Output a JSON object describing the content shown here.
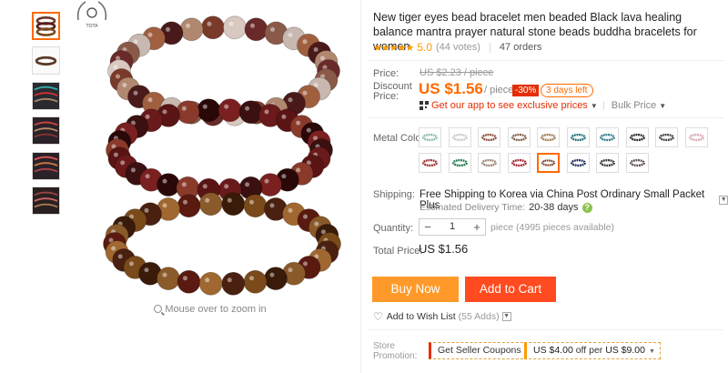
{
  "thumbnails": [
    {
      "name": "thumb-1",
      "selected": true
    },
    {
      "name": "thumb-2",
      "selected": false
    },
    {
      "name": "thumb-3",
      "selected": false
    },
    {
      "name": "thumb-4",
      "selected": false
    },
    {
      "name": "thumb-5",
      "selected": false
    },
    {
      "name": "thumb-6",
      "selected": false
    }
  ],
  "watermark": {
    "text": "TOTA"
  },
  "zoom_hint": "Mouse over to zoom in",
  "product": {
    "title": "New tiger eyes bead bracelet men beaded Black lava healing balance mantra prayer natural stone beads buddha bracelets for women",
    "stars": "★★★★★",
    "rating": "5.0",
    "votes": "(44 votes)",
    "orders": "47 orders"
  },
  "price": {
    "label": "Price:",
    "old_price": "US $2.23 / piece",
    "discount_label_1": "Discount",
    "discount_label_2": "Price:",
    "current": "US $1.56",
    "per": "/ piece",
    "discount_badge": "-30%",
    "days_left": "3 days left",
    "app_offer": "Get our app to see exclusive prices",
    "bulk_price": "Bulk Price"
  },
  "metal_color": {
    "label": "Metal Color:",
    "swatches": [
      {
        "color": "#8fb8ad"
      },
      {
        "color": "#c9c9c9"
      },
      {
        "color": "#8b4a3a"
      },
      {
        "color": "#7a5a48"
      },
      {
        "color": "#a07850"
      },
      {
        "color": "#1e6e74"
      },
      {
        "color": "#2b7a88"
      },
      {
        "color": "#222222"
      },
      {
        "color": "#3a3a3a"
      },
      {
        "color": "#d7a8b0"
      },
      {
        "color": "#9c2b2b"
      },
      {
        "color": "#1e7a4a"
      },
      {
        "color": "#9a8070"
      },
      {
        "color": "#a01f2a"
      },
      {
        "color": "#7a3a20"
      },
      {
        "color": "#1a2a5a"
      },
      {
        "color": "#303030"
      },
      {
        "color": "#5a4a4a"
      }
    ],
    "selected_index": 14
  },
  "shipping": {
    "label": "Shipping:",
    "text": "Free Shipping to Korea via China Post Ordinary Small Packet Plus",
    "delivery_label": "Estimated Delivery Time:",
    "delivery_days": "20-38 days"
  },
  "quantity": {
    "label": "Quantity:",
    "value": "1",
    "note": "piece (4995 pieces available)"
  },
  "total": {
    "label": "Total Price:",
    "value": "US $1.56"
  },
  "buttons": {
    "buy_now": "Buy Now",
    "add_to_cart": "Add to Cart"
  },
  "wishlist": {
    "label": "Add to Wish List",
    "count": "(55 Adds)"
  },
  "promotion": {
    "label_1": "Store",
    "label_2": "Promotion:",
    "coupon_1": "Get Seller Coupons",
    "coupon_2_prefix": "US $4.00",
    "coupon_2_mid": "off per",
    "coupon_2_suffix": "US $9.00"
  },
  "colors": {
    "accent": "#ff6a00",
    "buy": "#ff9a2a",
    "cart": "#ff4b1f",
    "badge": "#e62e04"
  }
}
